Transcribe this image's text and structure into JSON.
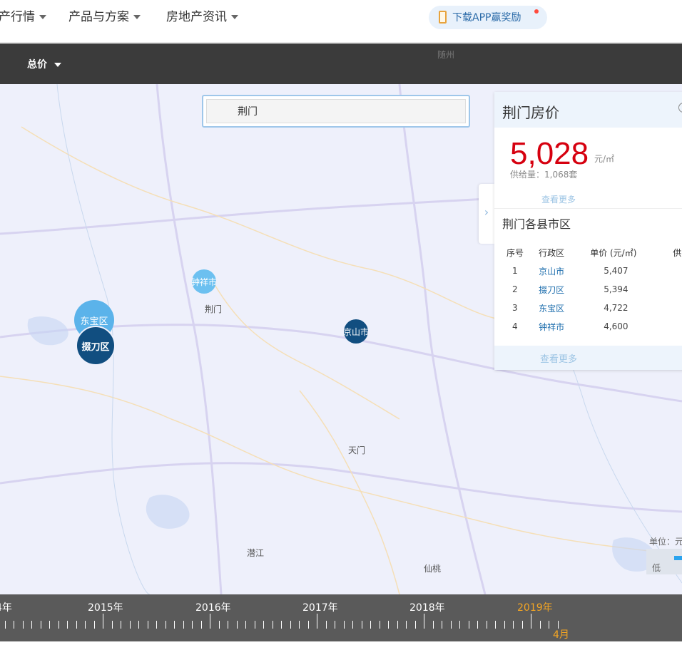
{
  "topnav": {
    "items": [
      {
        "label": "产行情"
      },
      {
        "label": "产品与方案"
      },
      {
        "label": "房地产资讯"
      }
    ],
    "app_button": "下载APP赢奖励"
  },
  "filterbar": {
    "total_label": "总价"
  },
  "map": {
    "labels": {
      "suizhou": "随州",
      "jingmen": "荆门",
      "tianmen": "天门",
      "qianjiang": "潜江",
      "xiantao": "仙桃"
    },
    "bubbles": {
      "zhongxiang": "钟祥市",
      "dongbao": "东宝区",
      "duodao": "掇刀区",
      "jingshan": "京山市"
    }
  },
  "search": {
    "value": "荆门"
  },
  "panel": {
    "title": "荆门房价",
    "price": "5,028",
    "price_unit": "元/㎡",
    "supply": "供给量：1,068套",
    "more_label": "查看更多",
    "districts_title": "荆门各县市区",
    "table": {
      "headers": [
        "序号",
        "行政区",
        "单价 (元/㎡)",
        "供"
      ],
      "rows": [
        {
          "no": "1",
          "name": "京山市",
          "price": "5,407"
        },
        {
          "no": "2",
          "name": "掇刀区",
          "price": "5,394"
        },
        {
          "no": "3",
          "name": "东宝区",
          "price": "4,722"
        },
        {
          "no": "4",
          "name": "钟祥市",
          "price": "4,600"
        }
      ]
    },
    "more_label_2": "查看更多"
  },
  "legend": {
    "unit": "单位：元",
    "low": "低"
  },
  "timeline": {
    "years": [
      "4年",
      "2015年",
      "2016年",
      "2017年",
      "2018年",
      "2019年"
    ],
    "active_year": "2019年",
    "month": "4月"
  },
  "colors": {
    "accent_blue": "#1f6fae",
    "price_red": "#d6000f",
    "bubble_light": "#5bb3ea",
    "bubble_dark": "#114e80",
    "timeline_active": "#f5a623"
  }
}
